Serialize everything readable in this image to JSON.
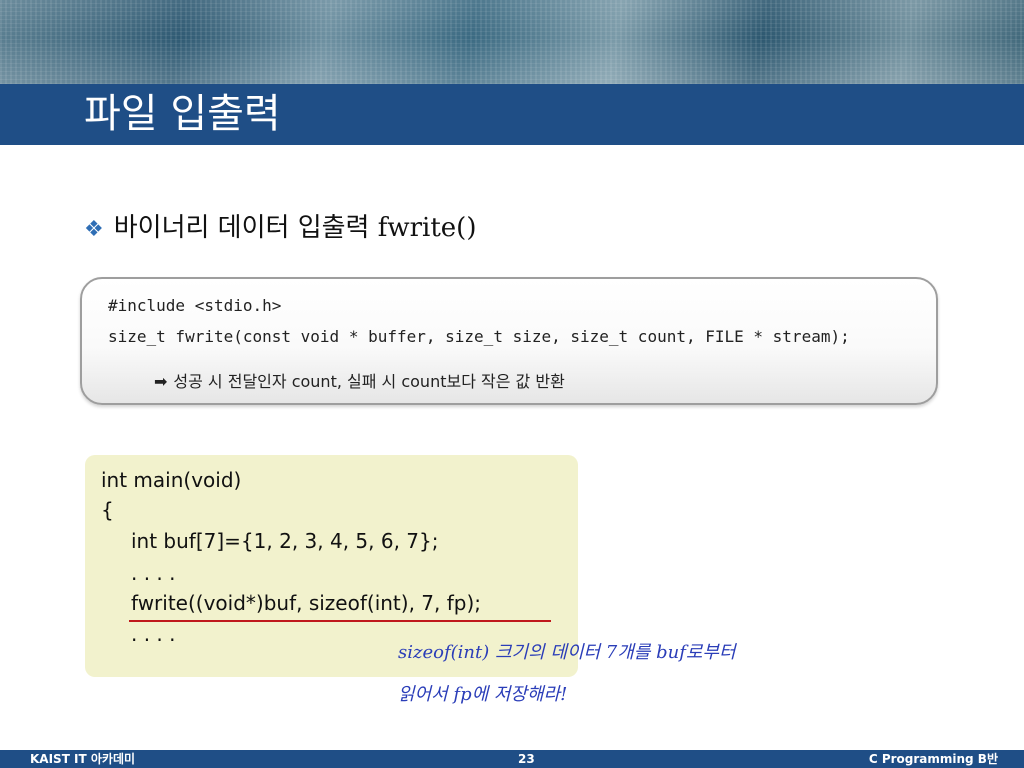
{
  "slide": {
    "title": "파일 입출력",
    "bullet_icon": "diamond-bullet-icon",
    "bullet_text": "바이너리 데이터 입출력 fwrite()"
  },
  "prototype": {
    "line1": "#include <stdio.h>",
    "line2": "size_t fwrite(const void * buffer, size_t size, size_t count, FILE * stream);",
    "arrow_icon": "right-arrow-icon",
    "note": "성공 시 전달인자 count, 실패 시 count보다 작은 값 반환"
  },
  "example": {
    "lines": [
      "int main(void)",
      "{",
      "int buf[7]={1, 2, 3, 4, 5, 6, 7};",
      ". . . .",
      "fwrite((void*)buf, sizeof(int), 7, fp);",
      ". . . ."
    ]
  },
  "annotation": {
    "line1": "sizeof(int) 크기의 데이터 7개를 buf로부터",
    "line2": "읽어서 fp에 저장해라!"
  },
  "footer": {
    "left": "KAIST IT 아카데미",
    "center": "23",
    "right": "C Programming B반"
  },
  "colors": {
    "title_bar": "#1f4e86",
    "example_bg": "#f2f2cd",
    "underline": "#c0191c",
    "annotation": "#2a3db8"
  }
}
